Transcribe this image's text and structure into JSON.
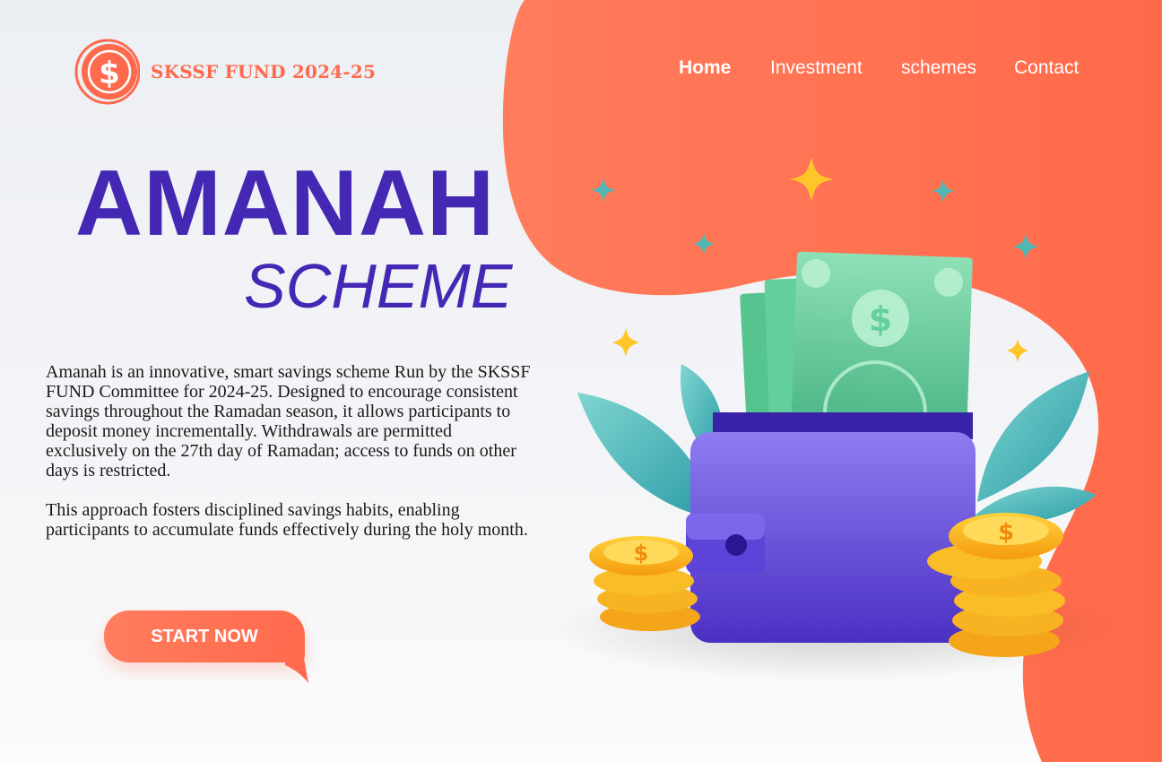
{
  "brand": {
    "name": "SKSSF FUND 2024-25",
    "accent": "#ff6a4d"
  },
  "nav": {
    "items": [
      {
        "label": "Home",
        "active": true
      },
      {
        "label": "Investment",
        "active": false
      },
      {
        "label": "schemes",
        "active": false
      },
      {
        "label": "Contact",
        "active": false
      }
    ]
  },
  "hero": {
    "title": "AMANAH",
    "subtitle": "SCHEME",
    "title_color": "#4428b3",
    "paragraphs": [
      "Amanah is an innovative, smart savings scheme Run by the SKSSF FUND Committee for 2024-25. Designed to encourage consistent savings throughout the Ramadan season, it allows participants to deposit money incrementally. Withdrawals are permitted exclusively on the 27th day of Ramadan; access to funds on other days is restricted.",
      "This approach fosters disciplined savings habits, enabling participants to accumulate funds effectively during the holy month."
    ],
    "cta": "START NOW"
  },
  "icons": [
    "dollar-coin-icon",
    "sparkle-icon",
    "wallet-icon",
    "banknote-icon",
    "coin-stack-icon",
    "leaf-icon"
  ]
}
